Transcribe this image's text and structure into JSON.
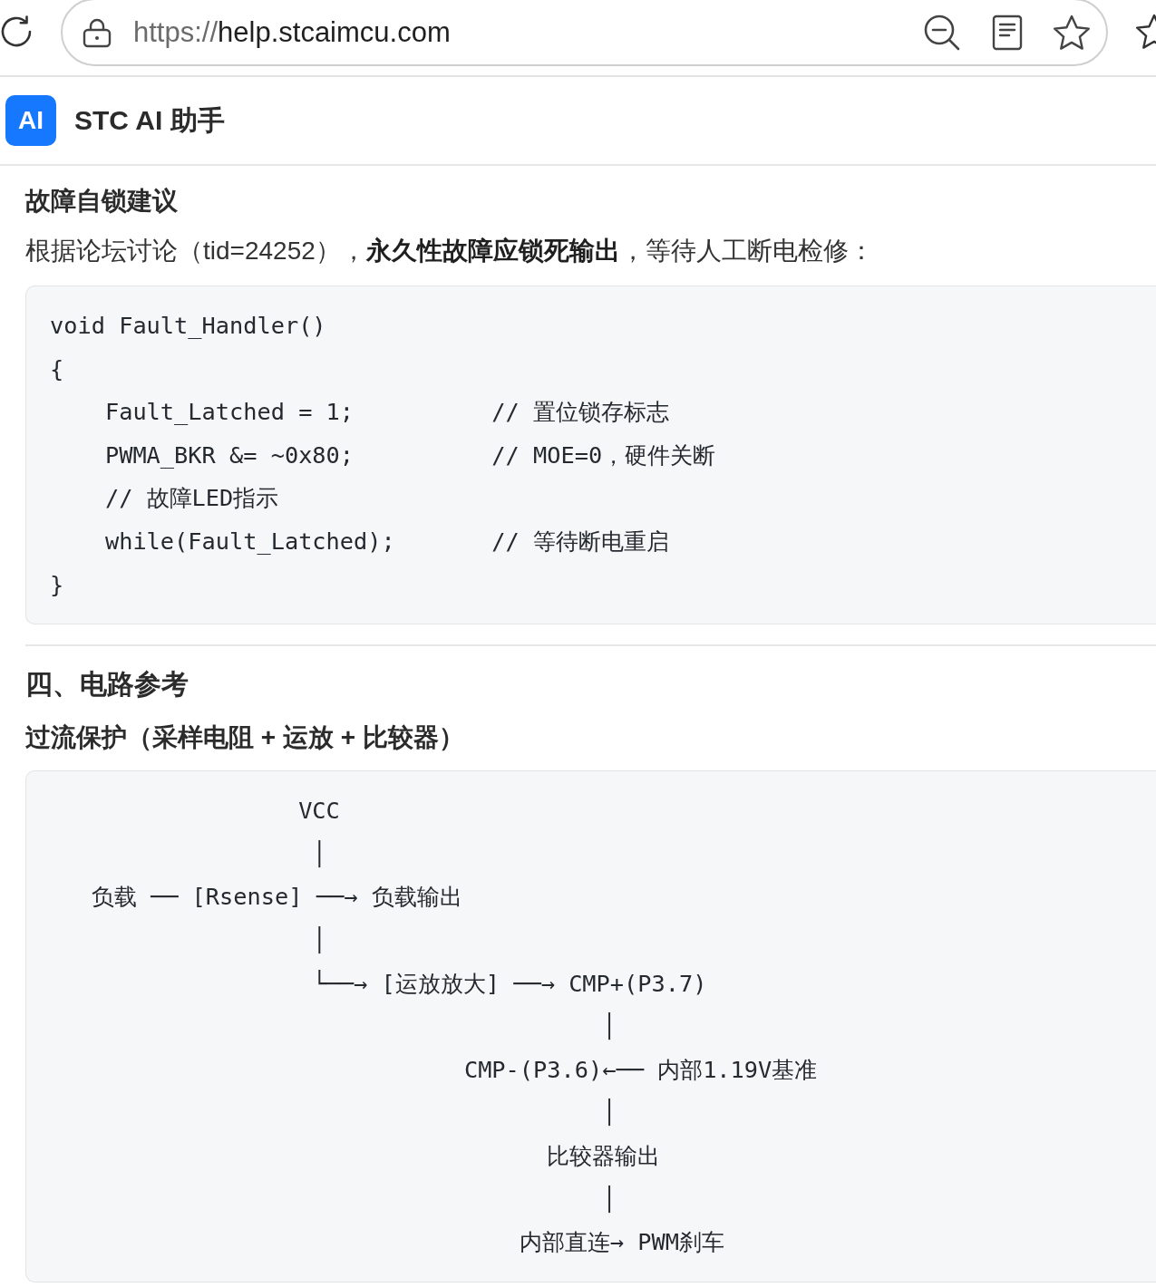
{
  "address_bar": {
    "scheme": "https://",
    "host": "help.stcaimcu.com"
  },
  "app_header": {
    "logo": "AI",
    "title": "STC AI 助手"
  },
  "content": [
    {
      "kind": "heading",
      "text": "故障自锁建议"
    },
    {
      "kind": "paragraph",
      "text": "根据论坛讨论（tid=24252），**永久性故障应锁死输出**，等待人工断电检修："
    },
    {
      "kind": "code",
      "lines": [
        "void Fault_Handler()",
        "{",
        "    Fault_Latched = 1;          // 置位锁存标志",
        "    PWMA_BKR &= ~0x80;          // MOE=0，硬件关断",
        "    // 故障LED指示",
        "    while(Fault_Latched);       // 等待断电重启",
        "}"
      ]
    },
    {
      "kind": "divider"
    },
    {
      "kind": "heading_large",
      "text": "四、电路参考"
    },
    {
      "kind": "heading",
      "text": "过流保护（采样电阻 + 运放 + 比较器）"
    },
    {
      "kind": "code",
      "lines": [
        "                  VCC",
        "                   │",
        "   负载 ── [Rsense] ──→ 负载输出",
        "                   │",
        "                   └──→ [运放放大] ──→ CMP+(P3.7)",
        "                                        │",
        "                              CMP-(P3.6)←── 内部1.19V基准",
        "                                        │",
        "                                    比较器输出",
        "                                        │",
        "                                  内部直连→ PWM刹车"
      ]
    }
  ]
}
